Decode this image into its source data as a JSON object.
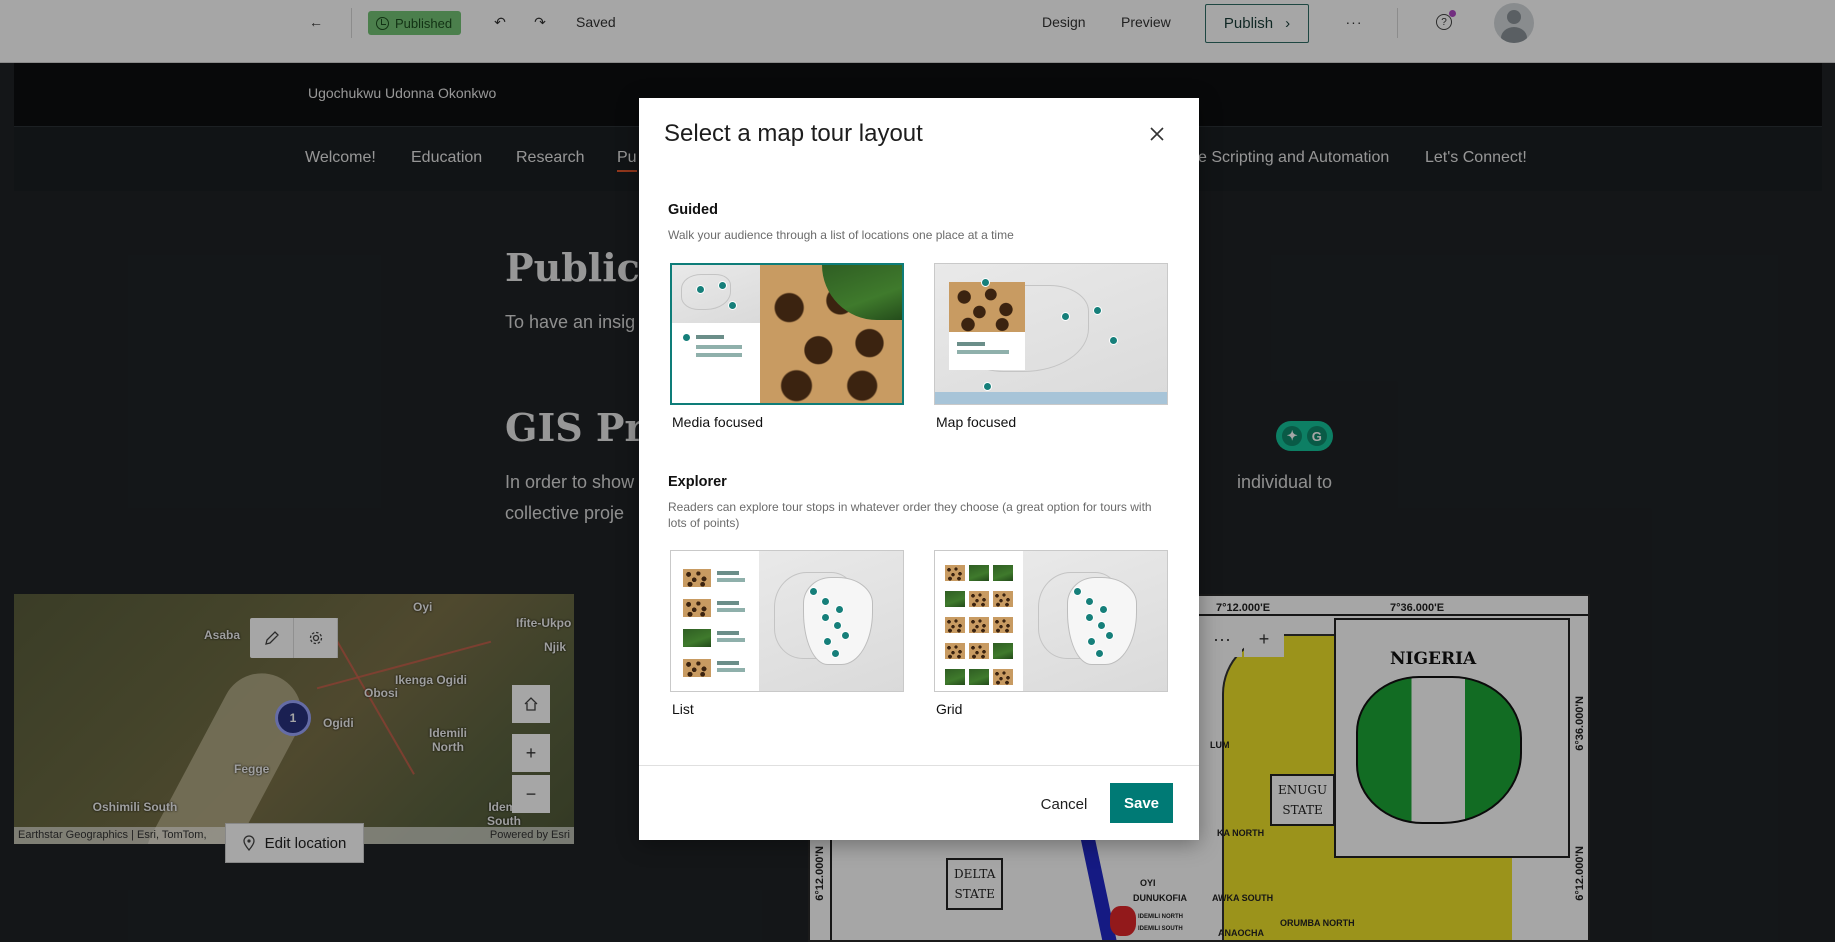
{
  "topbar": {
    "status": "Published",
    "saved": "Saved",
    "design": "Design",
    "preview": "Preview",
    "publish": "Publish",
    "more": "···"
  },
  "story": {
    "author": "Ugochukwu Udonna Okonkwo",
    "nav": [
      "Welcome!",
      "Education",
      "Research",
      "Pu",
      "e Scripting and Automation",
      "Let's Connect!"
    ],
    "heading_pub": "Publica",
    "para_pub": "To have an insig",
    "heading_gis": "GIS Pro",
    "para_gis_1": "In order to show",
    "para_gis_2": "collective proje",
    "para_gis_right": "individual to"
  },
  "map_left": {
    "towns": [
      "Oyi",
      "Asaba",
      "Ifite-Ukpo",
      "Njik",
      "Ikenga Ogidi",
      "Obosi",
      "Ogidi",
      "Idemili North",
      "Fegge",
      "Oshimili South",
      "Idemi South"
    ],
    "pin": "1",
    "attribution": "Earthstar Geographics | Esri, TomTom,",
    "powered": "Powered by Esri",
    "edit_location": "Edit location"
  },
  "map_right": {
    "coords_top": [
      "7°12.000'E",
      "7°36.000'E"
    ],
    "coords_side": [
      "6°36.000'N",
      "6°12.000'N"
    ],
    "coord_left": "6°12.000'N",
    "nigeria": "NIGERIA",
    "enugu_state_1": "ENUGU",
    "enugu_state_2": "STATE",
    "delta_state_1": "DELTA",
    "delta_state_2": "STATE",
    "labels": [
      "LUM",
      "KA NORTH",
      "OYI",
      "DUNUKOFIA",
      "AWKA SOUTH",
      "ORUMBA NORTH",
      "IDEMILI NORTH",
      "IDEMILI SOUTH",
      "ANAOCHA"
    ],
    "more": "···",
    "plus": "+"
  },
  "modal": {
    "title": "Select a map tour layout",
    "guided": {
      "title": "Guided",
      "desc": "Walk your audience through a list of locations one place at a time",
      "options": [
        {
          "label": "Media focused",
          "selected": true
        },
        {
          "label": "Map focused",
          "selected": false
        }
      ]
    },
    "explorer": {
      "title": "Explorer",
      "desc": "Readers can explore tour stops in whatever order they choose (a great option for tours with lots of points)",
      "options": [
        {
          "label": "List",
          "selected": false
        },
        {
          "label": "Grid",
          "selected": false
        }
      ]
    },
    "cancel": "Cancel",
    "save": "Save"
  },
  "colors": {
    "accent": "#007a75",
    "published_badge": "#74c476",
    "nav_active_underline": "#e0552c"
  },
  "icons": [
    "back-arrow-icon",
    "published-check-icon",
    "undo-icon",
    "redo-icon",
    "chevron-right-icon",
    "more-icon",
    "help-icon",
    "avatar-icon",
    "close-icon",
    "pencil-icon",
    "gear-icon",
    "home-icon",
    "zoom-in-icon",
    "zoom-out-icon",
    "location-pin-icon"
  ]
}
